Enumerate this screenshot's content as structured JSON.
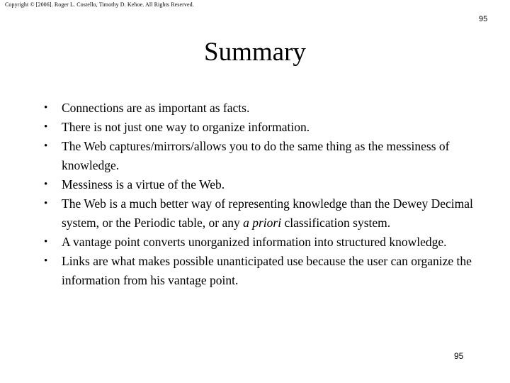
{
  "header": {
    "copyright": "Copyright © [2006].  Roger L. Costello, Timothy D. Kehoe.  All Rights Reserved.",
    "page_number_top": "95"
  },
  "footer": {
    "page_number_bottom": "95"
  },
  "title": "Summary",
  "bullet_marker": "•",
  "bullets": [
    {
      "id": "bullet-connections",
      "text": "Connections are as important as facts."
    },
    {
      "id": "bullet-organize-information",
      "text": "There is not just one way to organize information."
    },
    {
      "id": "bullet-web-captures-messiness",
      "text": "The Web captures/mirrors/allows you to do the same thing as the messiness of knowledge."
    },
    {
      "id": "bullet-messiness-virtue",
      "text": "Messiness is a virtue of the Web."
    },
    {
      "id": "bullet-web-better-than-dewey",
      "text_before_italic": "The Web is a much better way of representing knowledge than the Dewey Decimal system, or the Periodic table, or any ",
      "italic_text": "a priori",
      "text_after_italic": " classification system."
    },
    {
      "id": "bullet-vantage-point",
      "text": "A vantage point converts unorganized information into structured knowledge."
    },
    {
      "id": "bullet-links-unanticipated-use",
      "text": "Links are what makes possible unanticipated use because the user can organize the information from his vantage point."
    }
  ],
  "colors": {
    "background": "#ffffff",
    "text": "#000000"
  }
}
